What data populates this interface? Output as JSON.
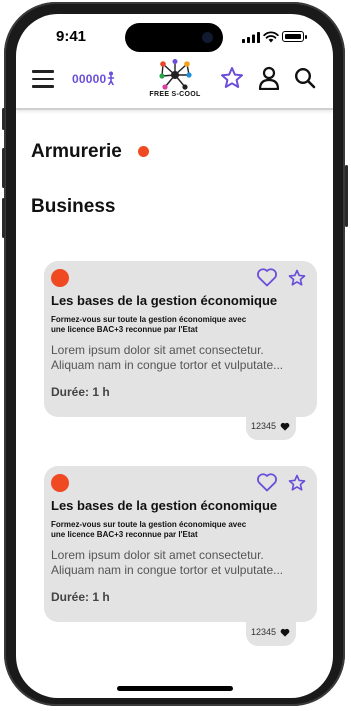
{
  "status_bar": {
    "time": "9:41"
  },
  "header": {
    "points": "00000",
    "logo_text": "FREE S-COOL"
  },
  "sections": [
    {
      "title": "Armurerie"
    },
    {
      "title": "Business"
    }
  ],
  "cards": [
    {
      "title": "Les bases de la gestion économique",
      "subtitle_line1": "Formez-vous sur toute la gestion économique avec",
      "subtitle_line2": "une licence BAC+3 reconnue par l'Etat",
      "body_line1": "Lorem ipsum dolor sit amet consectetur.",
      "body_line2": "Aliquam nam in congue tortor et vulputate...",
      "duration": "Durée: 1 h",
      "likes": "12345"
    },
    {
      "title": "Les bases de la gestion économique",
      "subtitle_line1": "Formez-vous sur toute la gestion économique avec",
      "subtitle_line2": "une licence BAC+3 reconnue par l'Etat",
      "body_line1": "Lorem ipsum dolor sit amet consectetur.",
      "body_line2": "Aliquam nam in congue tortor et vulputate...",
      "duration": "Durée: 1 h",
      "likes": "12345"
    }
  ],
  "colors": {
    "accent": "#6b4fd8",
    "dot": "#f04a23",
    "card_bg": "#e3e3e3"
  },
  "icons": [
    "menu-icon",
    "coin-person-icon",
    "star-icon",
    "user-icon",
    "search-icon",
    "heart-icon"
  ]
}
